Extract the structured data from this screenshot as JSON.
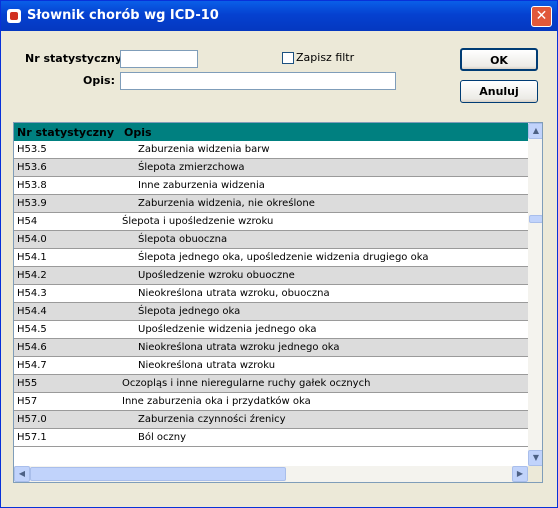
{
  "window": {
    "title": "Słownik chorób wg ICD-10",
    "close_glyph": "✕"
  },
  "filter": {
    "nr_label": "Nr statystyczny:",
    "nr_value": "",
    "opis_label": "Opis:",
    "opis_value": "",
    "save_filter_label": "Zapisz filtr",
    "save_filter_checked": false
  },
  "buttons": {
    "ok": "OK",
    "cancel": "Anuluj"
  },
  "grid": {
    "columns": [
      "Nr statystyczny",
      "Opis"
    ],
    "header_color": "#008080",
    "rows": [
      {
        "code": "H53.5",
        "desc": "Zaburzenia widzenia barw",
        "indent": 1
      },
      {
        "code": "H53.6",
        "desc": "Ślepota zmierzchowa",
        "indent": 1
      },
      {
        "code": "H53.8",
        "desc": "Inne zaburzenia widzenia",
        "indent": 1
      },
      {
        "code": "H53.9",
        "desc": "Zaburzenia widzenia, nie określone",
        "indent": 1
      },
      {
        "code": "H54",
        "desc": "Ślepota i upośledzenie wzroku",
        "indent": 0
      },
      {
        "code": "H54.0",
        "desc": "Ślepota obuoczna",
        "indent": 1
      },
      {
        "code": "H54.1",
        "desc": "Ślepota jednego oka, upośledzenie widzenia drugiego oka",
        "indent": 1
      },
      {
        "code": "H54.2",
        "desc": "Upośledzenie wzroku obuoczne",
        "indent": 1
      },
      {
        "code": "H54.3",
        "desc": "Nieokreślona utrata wzroku, obuoczna",
        "indent": 1
      },
      {
        "code": "H54.4",
        "desc": "Ślepota jednego oka",
        "indent": 1
      },
      {
        "code": "H54.5",
        "desc": "Upośledzenie widzenia jednego oka",
        "indent": 1
      },
      {
        "code": "H54.6",
        "desc": "Nieokreślona utrata wzroku jednego oka",
        "indent": 1
      },
      {
        "code": "H54.7",
        "desc": "Nieokreślona utrata wzroku",
        "indent": 1
      },
      {
        "code": "H55",
        "desc": "Oczopląs i inne nieregularne ruchy gałek ocznych",
        "indent": 0
      },
      {
        "code": "H57",
        "desc": "Inne zaburzenia oka i przydatków oka",
        "indent": 0
      },
      {
        "code": "H57.0",
        "desc": "Zaburzenia czynności źrenicy",
        "indent": 1
      },
      {
        "code": "H57.1",
        "desc": "Ból oczny",
        "indent": 1
      }
    ]
  },
  "scrollbars": {
    "up": "▲",
    "down": "▼",
    "left": "◀",
    "right": "▶"
  }
}
